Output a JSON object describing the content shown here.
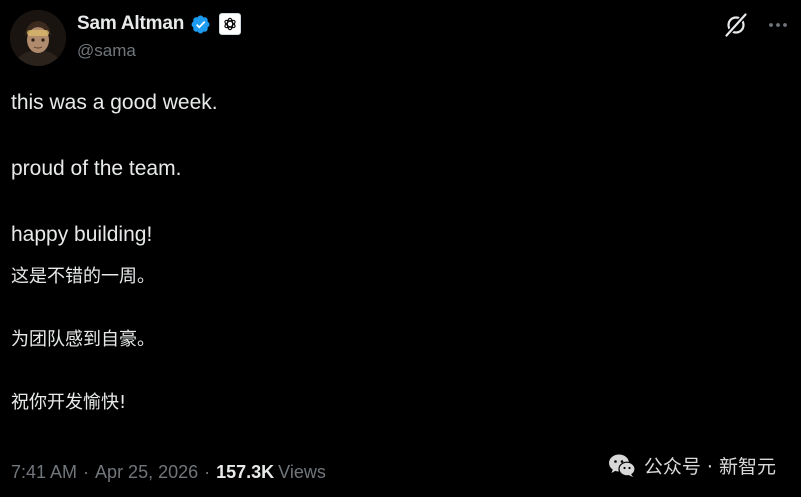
{
  "author": {
    "display_name": "Sam Altman",
    "handle": "@sama",
    "verified": true,
    "affiliate": "OpenAI"
  },
  "tweet": {
    "lines": [
      "this was a good week.",
      "proud of the team.",
      "happy building!"
    ],
    "translation_lines": [
      "这是不错的一周。",
      "为团队感到自豪。",
      "祝你开发愉快!"
    ]
  },
  "meta": {
    "time": "7:41 AM",
    "separator": "·",
    "date": "Apr 25, 2026",
    "views_count": "157.3K",
    "views_label": "Views"
  },
  "watermark": {
    "text": "公众号 · 新智元"
  },
  "icons": {
    "verified": "verified-badge-icon",
    "affiliate": "openai-logo-icon",
    "grok": "grok-icon",
    "more": "more-icon",
    "watermark": "wechat-icon"
  },
  "colors": {
    "background": "#000000",
    "text_primary": "#e7e9ea",
    "text_secondary": "#71767b",
    "verified_blue": "#1d9bf0"
  }
}
